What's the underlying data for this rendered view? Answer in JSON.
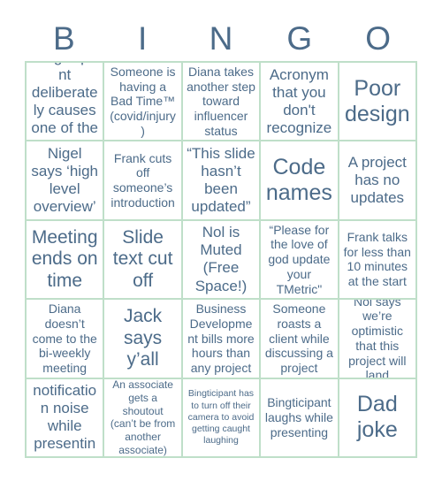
{
  "card": {
    "title": "BINGO",
    "header_letters": [
      "B",
      "I",
      "N",
      "G",
      "O"
    ],
    "colors": {
      "text": "#4c6b89",
      "border": "#bfdfc9",
      "background": "#ffffff"
    },
    "rows": [
      [
        {
          "text": "Bingticipant deliberately causes one of the terms",
          "size": "lg",
          "marked": false
        },
        {
          "text": "Someone is having a Bad Time™ (covid/injury)",
          "size": "md",
          "marked": false
        },
        {
          "text": "Diana takes another step toward influencer status",
          "size": "md",
          "marked": false
        },
        {
          "text": "Acronym that you don't recognize",
          "size": "lg",
          "marked": false
        },
        {
          "text": "Poor design",
          "size": "xxl",
          "marked": false
        }
      ],
      [
        {
          "text": "Nigel says ‘high level overview’",
          "size": "lg",
          "marked": false
        },
        {
          "text": "Frank cuts off someone’s introduction",
          "size": "md",
          "marked": false
        },
        {
          "text": "“This slide hasn’t been updated”",
          "size": "lg",
          "marked": false
        },
        {
          "text": "Code names",
          "size": "xxl",
          "marked": false
        },
        {
          "text": "A project has no updates",
          "size": "lg",
          "marked": false
        }
      ],
      [
        {
          "text": "Meeting ends on time",
          "size": "xl",
          "marked": false
        },
        {
          "text": "Slide text cut off",
          "size": "xl",
          "marked": false
        },
        {
          "text": "Nol is Muted (Free Space!)",
          "size": "lg",
          "marked": false
        },
        {
          "text": "“Please for the love of god update your TMetric\"",
          "size": "md",
          "marked": false
        },
        {
          "text": "Frank talks for less than 10 minutes at the start",
          "size": "md",
          "marked": false
        }
      ],
      [
        {
          "text": "Diana doesn’t come to the bi-weekly meeting",
          "size": "md",
          "marked": false
        },
        {
          "text": "Jack says y’all",
          "size": "xl",
          "marked": false
        },
        {
          "text": "Business Development bills more hours than any project",
          "size": "md",
          "marked": false
        },
        {
          "text": "Someone roasts a client while discussing a project",
          "size": "md",
          "marked": false
        },
        {
          "text": "Nol says we’re optimistic that this project will land",
          "size": "md",
          "marked": false
        }
      ],
      [
        {
          "text": "Slack notification noise while presenting",
          "size": "lg",
          "marked": false
        },
        {
          "text": "An associate gets a shoutout (can’t be from another associate)",
          "size": "sm",
          "marked": false
        },
        {
          "text": "Bingticipant has to turn off their camera to avoid getting caught laughing",
          "size": "xs",
          "marked": false
        },
        {
          "text": "Bingticipant laughs while presenting",
          "size": "md",
          "marked": false
        },
        {
          "text": "Dad joke",
          "size": "xxl",
          "marked": false
        }
      ]
    ]
  }
}
